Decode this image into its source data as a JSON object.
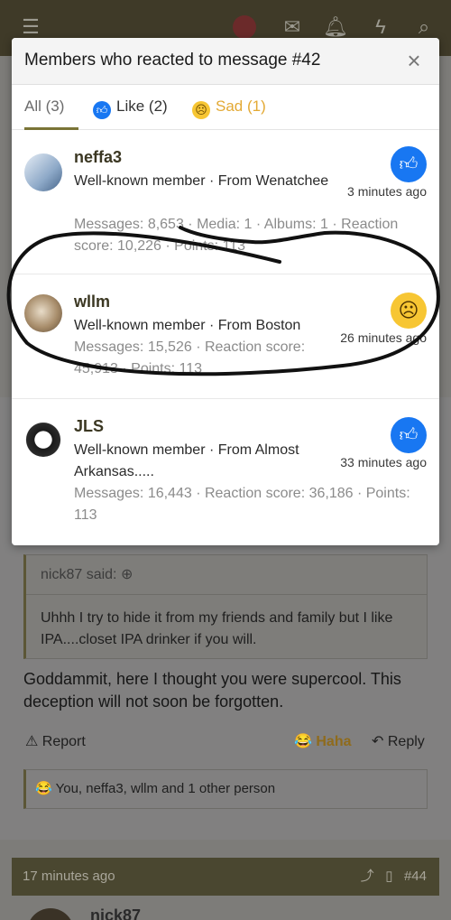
{
  "topbar": {
    "icons": [
      "menu-icon",
      "avatar",
      "mail-icon",
      "bell-icon",
      "bolt-icon",
      "search-icon"
    ]
  },
  "modal": {
    "title": "Members who reacted to message #42",
    "close_glyph": "×",
    "tabs": [
      {
        "label": "All (3)"
      },
      {
        "label": "Like (2)"
      },
      {
        "label": "Sad (1)"
      }
    ],
    "members": [
      {
        "name": "neffa3",
        "info": "Well-known member · From Wenatchee",
        "stats": "Messages: 8,653 · Media: 1 · Albums: 1 · Reaction score: 10,226 · Points: 113",
        "reaction": "like",
        "time": "3 minutes ago"
      },
      {
        "name": "wllm",
        "info": "Well-known member · From Boston",
        "stats": "Messages: 15,526 · Reaction score: 45,913 · Points: 113",
        "reaction": "sad",
        "time": "26 minutes ago"
      },
      {
        "name": "JLS",
        "info": "Well-known member · From Almost Arkansas.....",
        "stats": "Messages: 16,443 · Reaction score: 36,186 · Points: 113",
        "reaction": "like",
        "time": "33 minutes ago"
      }
    ]
  },
  "post": {
    "quote_author": "nick87 said:",
    "quote_text": "Uhhh I try to hide it from my friends and family but I like IPA....closet IPA drinker if you will.",
    "text": "Goddammit, here I thought you were supercool. This deception will not soon be forgotten.",
    "report_label": "Report",
    "haha_label": "Haha",
    "reply_label": "Reply",
    "reactions_summary": "You, neffa3, wllm and 1 other person"
  },
  "next_post": {
    "time": "17 minutes ago",
    "number": "#44",
    "author": "nick87"
  },
  "colors": {
    "like": "#1877f2",
    "sad": "#f7c633",
    "accent": "#7a7436"
  }
}
